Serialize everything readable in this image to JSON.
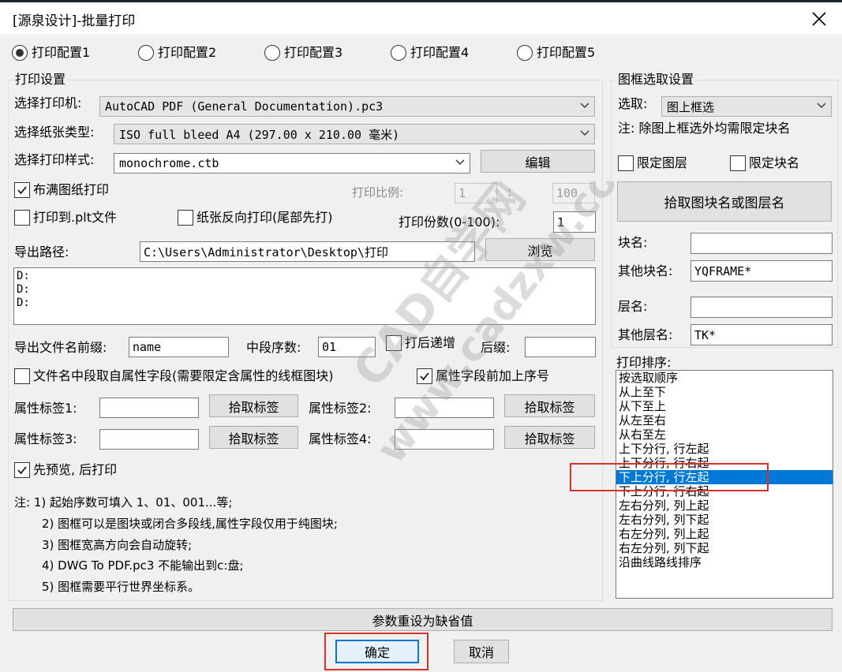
{
  "window": {
    "title": "[源泉设计]-批量打印",
    "close_icon": "close-icon"
  },
  "configs": [
    {
      "label": "打印配置1",
      "selected": true
    },
    {
      "label": "打印配置2",
      "selected": false
    },
    {
      "label": "打印配置3",
      "selected": false
    },
    {
      "label": "打印配置4",
      "selected": false
    },
    {
      "label": "打印配置5",
      "selected": false
    }
  ],
  "print_settings": {
    "group_label": "打印设置",
    "printer_label": "选择打印机:",
    "printer_value": "AutoCAD PDF (General Documentation).pc3",
    "paper_label": "选择纸张类型:",
    "paper_value": "ISO full bleed A4 (297.00 x 210.00 毫米)",
    "style_label": "选择打印样式:",
    "style_value": "monochrome.ctb",
    "edit_button": "编辑",
    "fit_paper_label": "布满图纸打印",
    "fit_paper_checked": true,
    "scale_label": "打印比例:",
    "scale_num": "1",
    "scale_sep": ":",
    "scale_den": "100",
    "plt_label": "打印到.plt文件",
    "plt_checked": false,
    "reverse_label": "纸张反向打印(尾部先打)",
    "reverse_checked": false,
    "copies_label": "打印份数(0-100):",
    "copies_value": "1",
    "path_label": "导出路径:",
    "path_value": "C:\\Users\\Administrator\\Desktop\\打印",
    "browse_button": "浏览",
    "path_list": [
      "D:",
      "D:",
      "D:"
    ],
    "prefix_label": "导出文件名前缀:",
    "prefix_value": "name",
    "mid_label": "中段序数:",
    "mid_value": "01",
    "increment_label": "打后递增",
    "increment_checked": false,
    "suffix_label": "后缀:",
    "suffix_value": "",
    "attr_mid_label": "文件名中段取自属性字段(需要限定含属性的线框图块)",
    "attr_mid_checked": false,
    "attr_seq_label": "属性字段前加上序号",
    "attr_seq_checked": true,
    "tag1_label": "属性标签1:",
    "tag2_label": "属性标签2:",
    "tag3_label": "属性标签3:",
    "tag4_label": "属性标签4:",
    "pick_tag_button": "拾取标签",
    "preview_label": "先预览, 后打印",
    "preview_checked": true,
    "notes": [
      "注: 1) 起始序数可填入 1、01、001...等;",
      "2) 图框可以是图块或闭合多段线,属性字段仅用于纯图块;",
      "3) 图框宽高方向会自动旋转;",
      "4) DWG To PDF.pc3 不能输出到c:盘;",
      "5) 图框需要平行世界坐标系。"
    ]
  },
  "frame_settings": {
    "group_label": "图框选取设置",
    "select_label": "选取:",
    "select_value": "图上框选",
    "note": "注: 除图上框选外均需限定块名",
    "limit_layer_label": "限定图层",
    "limit_layer_checked": false,
    "limit_block_label": "限定块名",
    "limit_block_checked": false,
    "pick_button": "拾取图块名或图层名",
    "block_name_label": "块名:",
    "block_name_value": "",
    "other_block_label": "其他块名:",
    "other_block_value": "YQFRAME*",
    "layer_label": "层名:",
    "layer_value": "",
    "other_layer_label": "其他层名:",
    "other_layer_value": "TK*",
    "order_label": "打印排序:",
    "order_items": [
      "按选取顺序",
      "从上至下",
      "从下至上",
      "从左至右",
      "从右至左",
      "上下分行, 行左起",
      "上下分行, 行右起",
      "下上分行, 行左起",
      "下上分行, 行右起",
      "左右分列, 列上起",
      "左右分列, 列下起",
      "右左分列, 列上起",
      "右左分列, 列下起",
      "沿曲线路线排序"
    ],
    "order_selected": "下上分行, 行左起"
  },
  "footer": {
    "reset_button": "参数重设为缺省值",
    "ok_button": "确定",
    "cancel_button": "取消"
  },
  "watermark": {
    "line1": "CAD自学网",
    "line2": "www.cadzxw.com"
  },
  "colors": {
    "selection": "#0078d7",
    "highlight_box": "#d9302c"
  }
}
